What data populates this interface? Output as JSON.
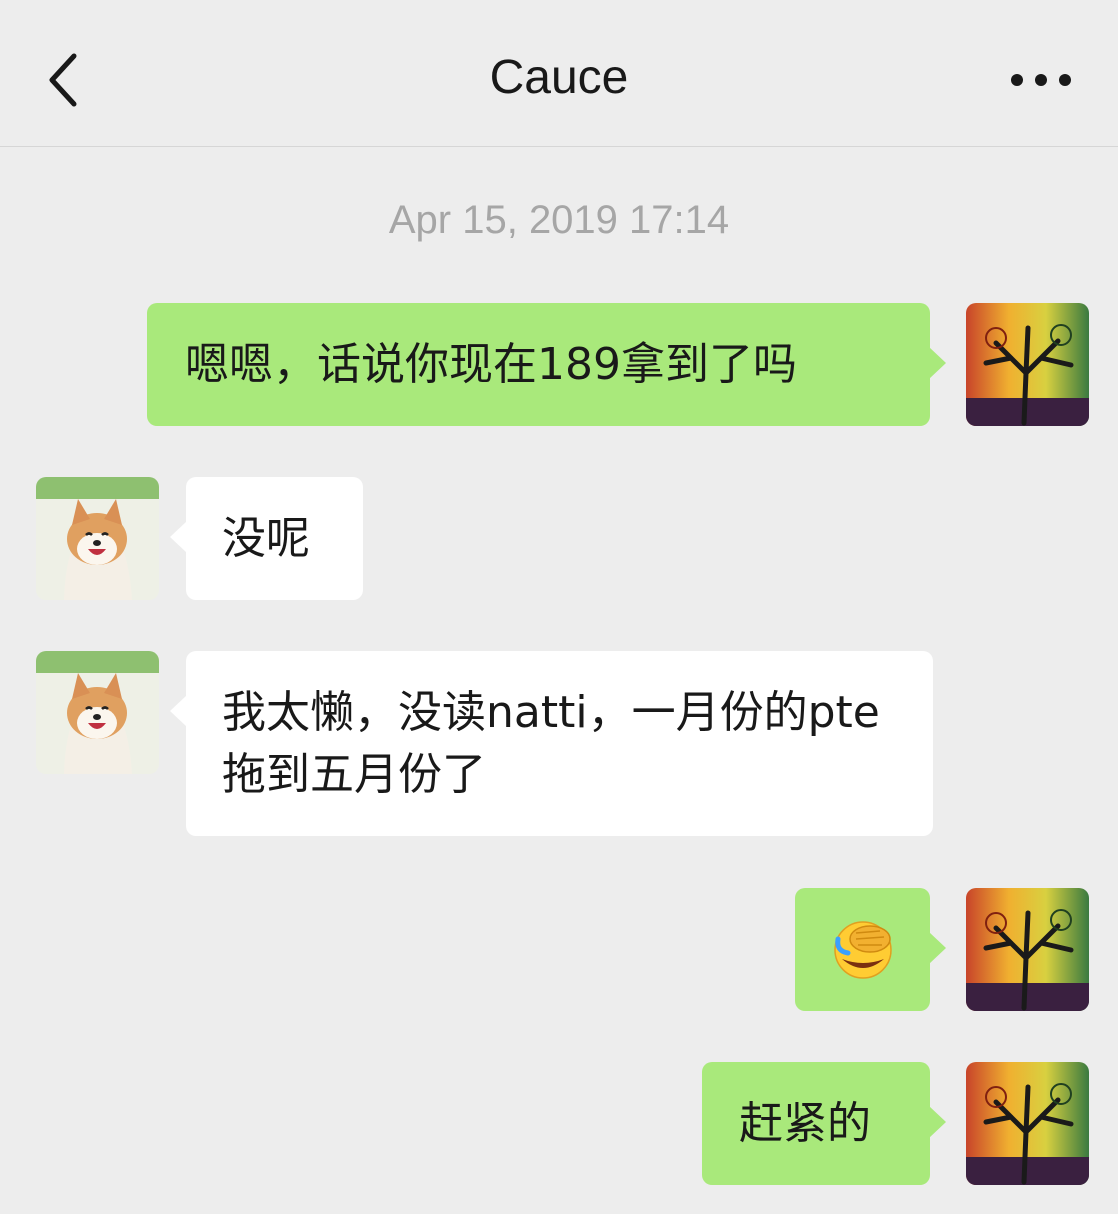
{
  "header": {
    "title": "Cauce",
    "back_icon": "chevron-left-icon",
    "more_icon": "more-dots-icon"
  },
  "timestamp": "Apr 15, 2019 17:14",
  "messages": [
    {
      "side": "right",
      "text": "嗯嗯，话说你现在189拿到了吗"
    },
    {
      "side": "left",
      "text": "没呢"
    },
    {
      "side": "left",
      "text": "我太懒，没读natti，一月份的pte拖到五月份了"
    },
    {
      "side": "right",
      "emoji": "face-palm-laughing",
      "text": ""
    },
    {
      "side": "right",
      "text": "赶紧的"
    }
  ],
  "colors": {
    "background": "#ededed",
    "sent_bubble": "#a9e97b",
    "received_bubble": "#ffffff",
    "timestamp": "#a6a6a6"
  }
}
